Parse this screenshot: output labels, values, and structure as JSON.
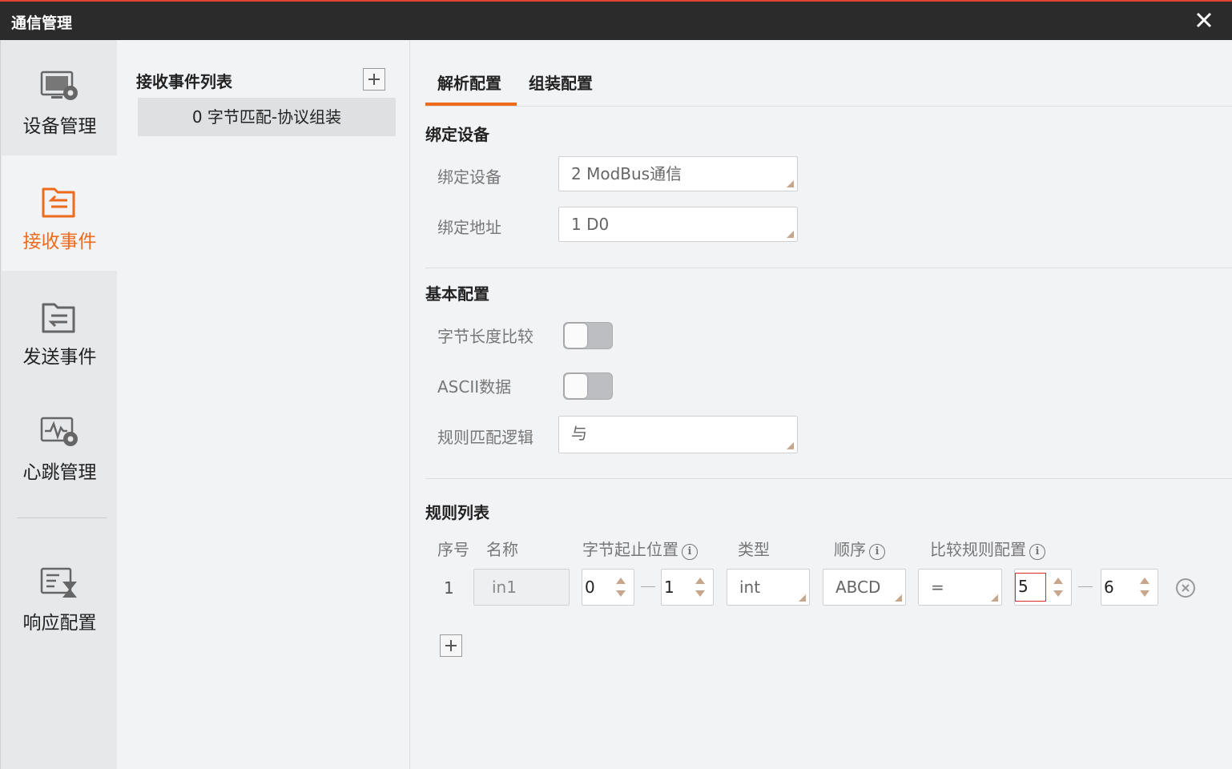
{
  "window": {
    "title": "通信管理"
  },
  "sidebar": {
    "items": [
      {
        "label": "设备管理",
        "icon": "device-settings-icon"
      },
      {
        "label": "接收事件",
        "icon": "receive-event-icon",
        "active": true
      },
      {
        "label": "发送事件",
        "icon": "send-event-icon"
      },
      {
        "label": "心跳管理",
        "icon": "heartbeat-icon"
      },
      {
        "label": "响应配置",
        "icon": "response-config-icon"
      }
    ]
  },
  "event_list": {
    "header": "接收事件列表",
    "items": [
      {
        "label": "0 字节匹配-协议组装"
      }
    ]
  },
  "tabs": [
    {
      "label": "解析配置",
      "active": true
    },
    {
      "label": "组装配置"
    }
  ],
  "bind_section": {
    "title": "绑定设备",
    "device_label": "绑定设备",
    "device_value": "2 ModBus通信",
    "address_label": "绑定地址",
    "address_value": "1 D0"
  },
  "basic_section": {
    "title": "基本配置",
    "byte_length_label": "字节长度比较",
    "byte_length_on": false,
    "ascii_label": "ASCII数据",
    "ascii_on": false,
    "logic_label": "规则匹配逻辑",
    "logic_value": "与"
  },
  "rules_section": {
    "title": "规则列表",
    "columns": {
      "index": "序号",
      "name": "名称",
      "byte_range": "字节起止位置",
      "type": "类型",
      "order": "顺序",
      "compare": "比较规则配置"
    },
    "rows": [
      {
        "index": "1",
        "name": "in1",
        "byte_start": "0",
        "byte_end": "1",
        "type": "int",
        "order": "ABCD",
        "operator": "=",
        "compare_from": "5",
        "compare_to": "6"
      }
    ]
  },
  "colors": {
    "accent": "#ee6a1c",
    "titlebar": "#2b2b2b",
    "focus_border": "#e0272c"
  }
}
